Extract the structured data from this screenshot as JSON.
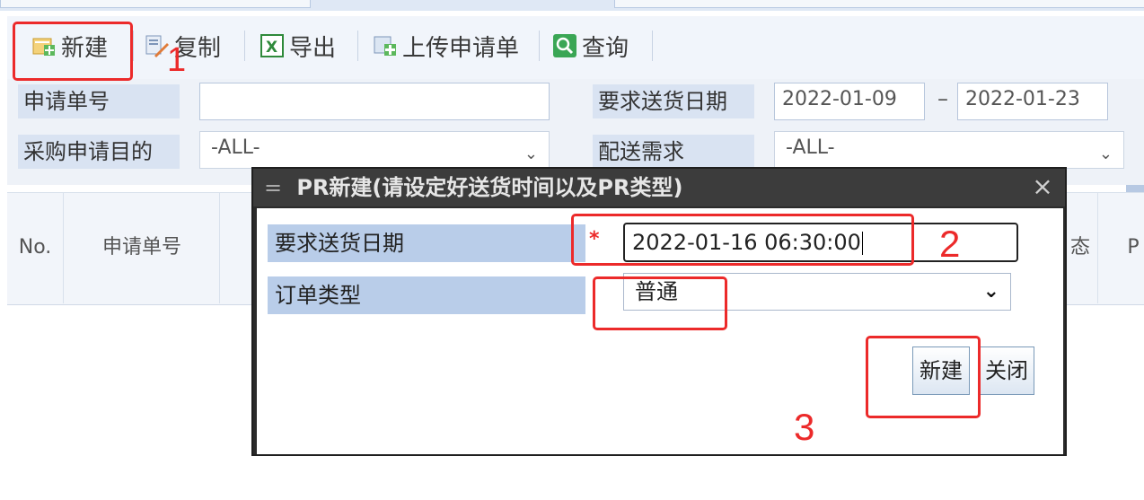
{
  "toolbar": {
    "items": [
      {
        "label": "新建",
        "icon": "new-doc-icon"
      },
      {
        "label": "复制",
        "icon": "copy-icon"
      },
      {
        "label": "导出",
        "icon": "excel-export-icon"
      },
      {
        "label": "上传申请单",
        "icon": "upload-icon"
      },
      {
        "label": "查询",
        "icon": "search-icon"
      }
    ]
  },
  "form": {
    "request_no_label": "申请单号",
    "request_no_value": "",
    "purpose_label": "采购申请目的",
    "purpose_value": "-ALL-",
    "delivery_date_label": "要求送货日期",
    "date_from": "2022-01-09",
    "date_sep": "–",
    "date_to": "2022-01-23",
    "delivery_need_label": "配送需求",
    "delivery_need_value": "-ALL-"
  },
  "table": {
    "headers": [
      "No.",
      "申请单号",
      "态",
      "P"
    ]
  },
  "dialog": {
    "title": "PR新建(请设定好送货时间以及PR类型)",
    "close_glyph": "×",
    "menu_glyph": "=",
    "delivery_label": "要求送货日期",
    "required_mark": "*",
    "delivery_value": "2022-01-16 06:30:00",
    "order_type_label": "订单类型",
    "order_type_value": "普通",
    "create_button": "新建",
    "close_button": "关闭"
  },
  "annotations": {
    "step1": "1",
    "step2": "2",
    "step3": "3",
    "color": "#ec2a2a"
  }
}
